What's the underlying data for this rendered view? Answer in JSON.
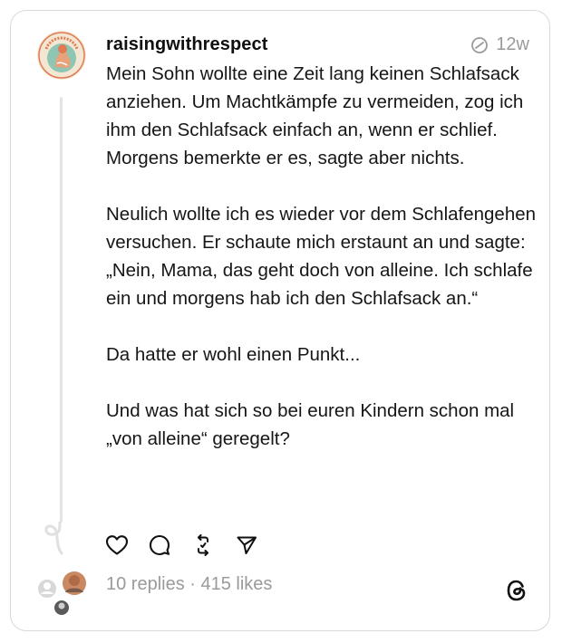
{
  "post": {
    "username": "raisingwithrespect",
    "time": "12w",
    "avatar_logo_text": "RAISING WITH RESPECT",
    "paragraphs": [
      "Mein Sohn wollte eine Zeit lang keinen Schlafsack anziehen. Um Machtkämpfe zu vermeiden, zog ich ihm den Schlafsack einfach an, wenn er schlief. Morgens bemerkte er es, sagte aber nichts.",
      "Neulich wollte ich es wieder vor dem Schlafengehen versuchen. Er schaute mich erstaunt an und sagte: „Nein, Mama, das geht doch von alleine. Ich schlafe ein und morgens hab ich den Schlafsack an.“",
      "Da hatte er wohl einen Punkt...",
      "Und was hat sich so bei euren Kindern schon mal „von alleine“ geregelt?"
    ],
    "stats": "10 replies · 415 likes"
  },
  "actions": [
    "heart-icon",
    "comment-icon",
    "repost-icon",
    "share-icon"
  ],
  "colors": {
    "text": "#161616",
    "muted": "#9a9a9a",
    "border": "#d9d9d9",
    "line": "#e4e4e4"
  }
}
